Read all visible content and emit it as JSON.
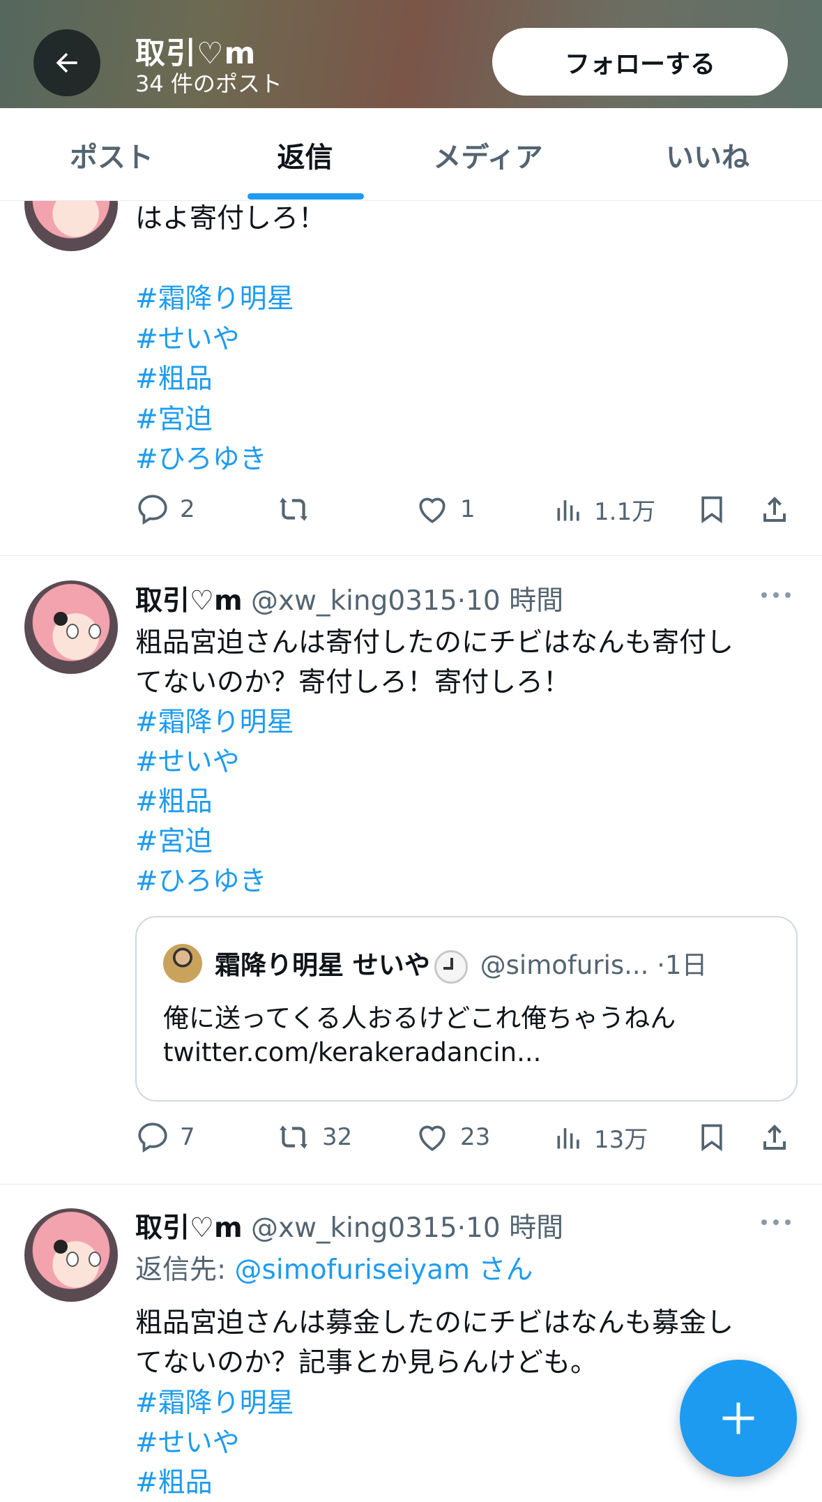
{
  "header": {
    "title": "取引♡m",
    "post_count": "34 件のポスト",
    "follow_label": "フォローする",
    "back_icon": "arrow-left-icon"
  },
  "tabs": [
    {
      "label": "ポスト",
      "active": false
    },
    {
      "label": "返信",
      "active": true
    },
    {
      "label": "メディア",
      "active": false
    },
    {
      "label": "いいね",
      "active": false
    }
  ],
  "posts": [
    {
      "text_lines": [
        "はよ寄付しろ！"
      ],
      "hashtags": [
        "#霜降り明星",
        "#せいや",
        "#粗品",
        "#宮迫",
        "#ひろゆき"
      ],
      "stats": {
        "replies": "2",
        "reposts": "",
        "likes": "1",
        "views": "1.1万"
      }
    },
    {
      "name": "取引♡m",
      "handle": "@xw_king0315",
      "time": "10 時間",
      "text_lines": [
        "粗品宮迫さんは寄付したのにチビはなんも寄付し",
        "てないのか？寄付しろ！寄付しろ！"
      ],
      "hashtags": [
        "#霜降り明星",
        "#せいや",
        "#粗品",
        "#宮迫",
        "#ひろゆき"
      ],
      "quote": {
        "name": "霜降り明星 せいや",
        "handle": "@simofuris...",
        "time": "1日",
        "text_lines": [
          "俺に送ってくる人おるけどこれ俺ちゃうねん",
          "twitter.com/kerakeradancin..."
        ]
      },
      "stats": {
        "replies": "7",
        "reposts": "32",
        "likes": "23",
        "views": "13万"
      }
    },
    {
      "name": "取引♡m",
      "handle": "@xw_king0315",
      "time": "10 時間",
      "reply_to_prefix": "返信先: ",
      "reply_to_user": "@simofuriseiyam",
      "reply_to_suffix": " さん",
      "text_lines": [
        "粗品宮迫さんは募金したのにチビはなんも募金し",
        "てないのか？記事とか見らんけども。"
      ],
      "hashtags": [
        "#霜降り明星",
        "#せいや",
        "#粗品"
      ]
    }
  ],
  "fab_icon": "plus-icon",
  "colors": {
    "accent": "#1d9bf0",
    "muted": "#536471",
    "text": "#0f1419"
  }
}
